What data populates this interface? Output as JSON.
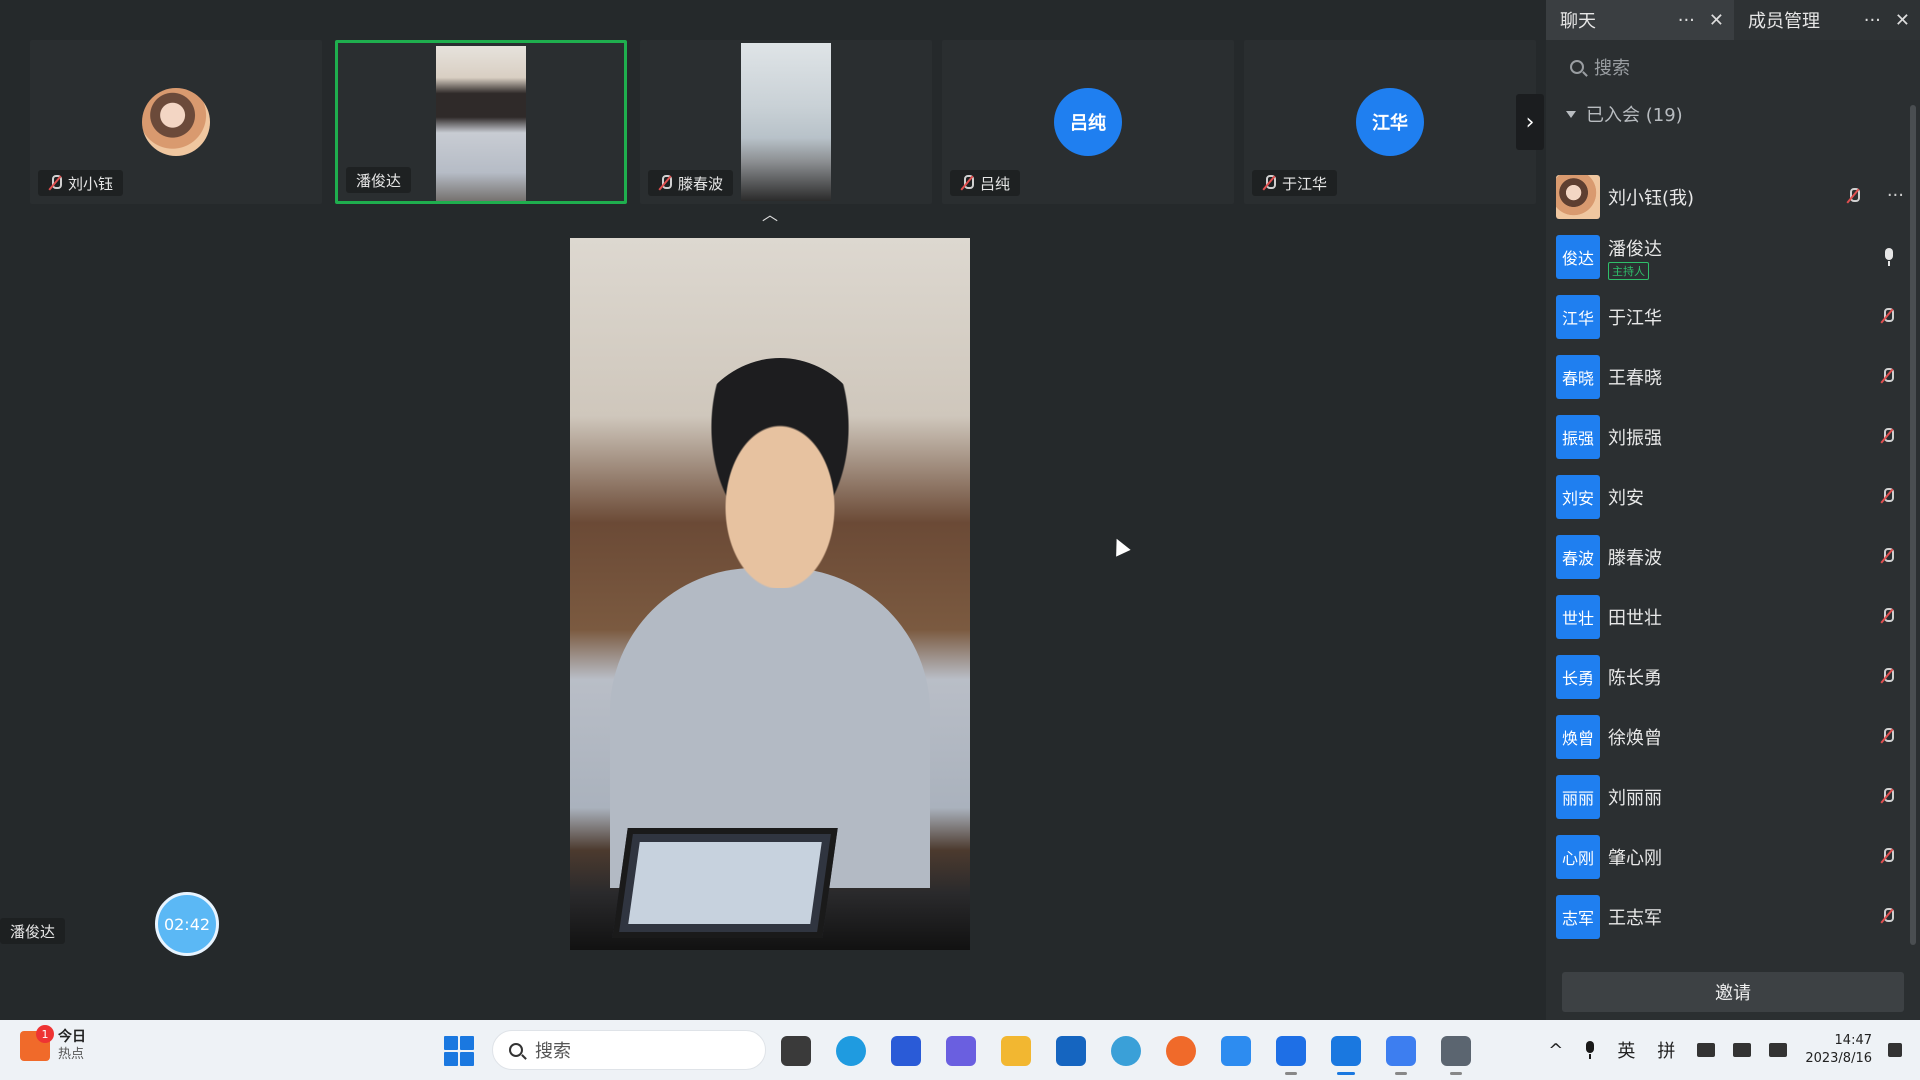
{
  "strip": {
    "tiles": [
      {
        "name": "刘小钰",
        "kind": "photo",
        "muted": true
      },
      {
        "name": "潘俊达",
        "kind": "camera",
        "muted": false,
        "active": true
      },
      {
        "name": "滕春波",
        "kind": "camera",
        "muted": true
      },
      {
        "name": "吕纯",
        "kind": "initials",
        "initials": "吕纯",
        "muted": true
      },
      {
        "name": "于江华",
        "kind": "initials",
        "initials": "江华",
        "muted": true
      }
    ],
    "next_arrow": "›",
    "collapse_arrow": "︿"
  },
  "main": {
    "speaker_name": "潘俊达",
    "timer": "02:42"
  },
  "panel": {
    "tab_chat": "聊天",
    "tab_members": "成员管理",
    "more_glyph": "···",
    "close_glyph": "✕",
    "search_placeholder": "搜索",
    "section_title": "已入会 (19)",
    "host_badge": "主持人",
    "invite_label": "邀请",
    "members": [
      {
        "initials": "",
        "name": "刘小钰(我)",
        "mic": "muted",
        "photo": true,
        "self": true
      },
      {
        "initials": "俊达",
        "name": "潘俊达",
        "mic": "on",
        "host": true
      },
      {
        "initials": "江华",
        "name": "于江华",
        "mic": "muted"
      },
      {
        "initials": "春晓",
        "name": "王春晓",
        "mic": "muted"
      },
      {
        "initials": "振强",
        "name": "刘振强",
        "mic": "muted"
      },
      {
        "initials": "刘安",
        "name": "刘安",
        "mic": "muted"
      },
      {
        "initials": "春波",
        "name": "滕春波",
        "mic": "muted"
      },
      {
        "initials": "世壮",
        "name": "田世壮",
        "mic": "muted"
      },
      {
        "initials": "长勇",
        "name": "陈长勇",
        "mic": "muted"
      },
      {
        "initials": "焕曾",
        "name": "徐焕曾",
        "mic": "muted"
      },
      {
        "initials": "丽丽",
        "name": "刘丽丽",
        "mic": "muted"
      },
      {
        "initials": "心刚",
        "name": "肇心刚",
        "mic": "muted"
      },
      {
        "initials": "志军",
        "name": "王志军",
        "mic": "muted"
      }
    ]
  },
  "taskbar": {
    "news_badge": "1",
    "news_title": "今日",
    "news_sub": "热点",
    "search_placeholder": "搜索",
    "apps": [
      {
        "name": "task-view-icon",
        "color": "#3a3a3a"
      },
      {
        "name": "edge-browser-icon",
        "color": "#1f9be0"
      },
      {
        "name": "microsoft-store-icon",
        "color": "#2a5bd7"
      },
      {
        "name": "copilot-icon",
        "color": "#6a5fe0"
      },
      {
        "name": "file-explorer-icon",
        "color": "#f2b731"
      },
      {
        "name": "security-app-icon",
        "color": "#1565c0"
      },
      {
        "name": "browser-app-icon",
        "color": "#3aa0d8"
      },
      {
        "name": "firefox-icon",
        "color": "#f06a2a"
      },
      {
        "name": "chat-app-icon",
        "color": "#2d8cf0"
      },
      {
        "name": "feishu-icon",
        "color": "#1e6fe6"
      },
      {
        "name": "meeting-app-icon",
        "color": "#1a78e0"
      },
      {
        "name": "screen-record-icon",
        "color": "#3d7ef0"
      },
      {
        "name": "settings-icon",
        "color": "#5b6570"
      }
    ],
    "tray_caret": "^",
    "ime_lang": "英",
    "ime_mode": "拼",
    "time": "14:47",
    "date": "2023/8/16"
  }
}
